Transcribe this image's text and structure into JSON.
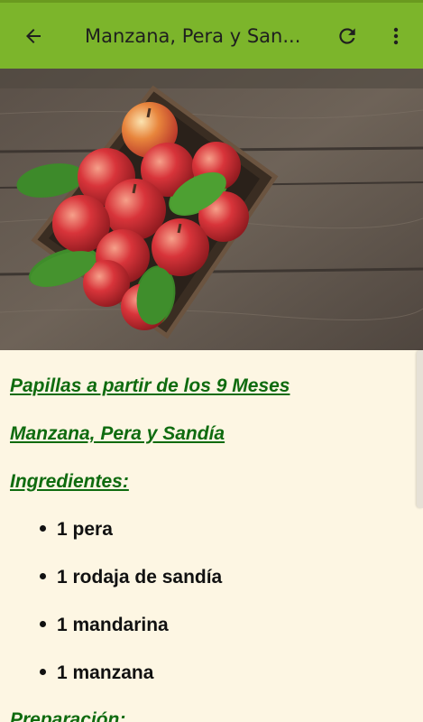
{
  "app_bar": {
    "title": "Manzana, Pera y San...",
    "back_icon": "arrow-back-icon",
    "refresh_icon": "refresh-icon",
    "more_icon": "more-vert-icon",
    "color": "#7cb52b"
  },
  "hero_image": {
    "subject": "basket-of-red-apples-on-wooden-table"
  },
  "content": {
    "section_title": "Papillas a partir de los 9 Meses",
    "recipe_title": "Manzana, Pera y Sandía",
    "ingredients_heading": "Ingredientes:",
    "ingredients": [
      "1 pera",
      "1 rodaja de sandía",
      "1 mandarina",
      "1 manzana"
    ],
    "preparation_heading": "Preparación:",
    "link_color": "#0f6b0f"
  }
}
